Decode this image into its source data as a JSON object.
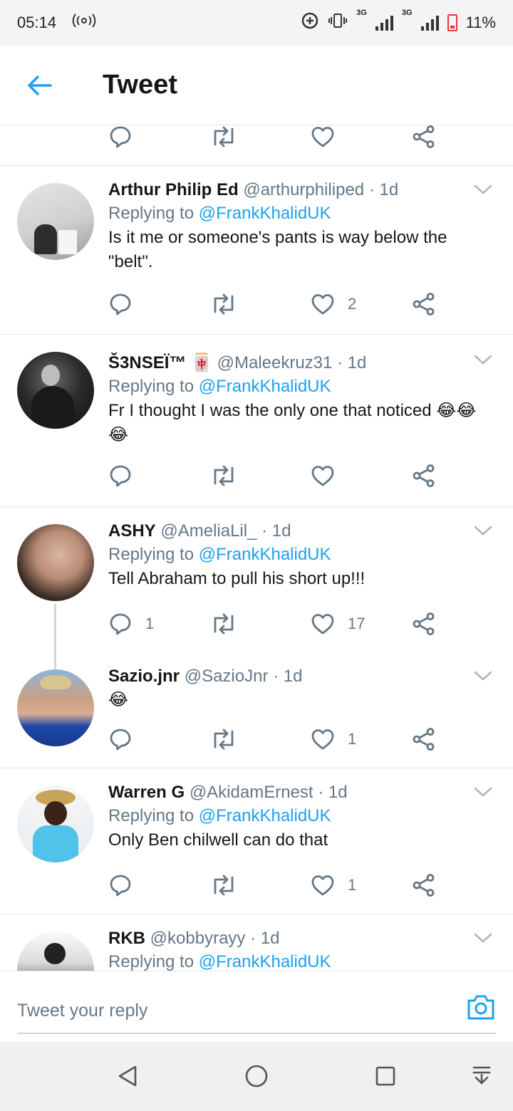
{
  "status_bar": {
    "time": "05:14",
    "network": "3G",
    "battery": "11%"
  },
  "header": {
    "title": "Tweet"
  },
  "tweets": [
    {
      "name": "Arthur Philip Ed",
      "handle": "@arthurphiliped",
      "time": "· 1d",
      "replying_prefix": "Replying to",
      "replying_to": "@FrankKhalidUK",
      "text": "Is it me or someone's pants is way below the \"belt\".",
      "replies": "",
      "likes": "2"
    },
    {
      "name": "Š3NSEÏ™",
      "badge": "🀄",
      "handle": "@Maleekruz31",
      "time": "· 1d",
      "replying_prefix": "Replying to",
      "replying_to": "@FrankKhalidUK",
      "text": "Fr I thought I was the only one that noticed 😂😂😂",
      "replies": "",
      "likes": ""
    },
    {
      "name": "ASHY",
      "handle": "@AmeliaLil_",
      "time": "· 1d",
      "replying_prefix": "Replying to",
      "replying_to": "@FrankKhalidUK",
      "text": "Tell Abraham to pull his short up!!!",
      "replies": "1",
      "likes": "17"
    },
    {
      "name": "Sazio.jnr",
      "handle": "@SazioJnr",
      "time": "· 1d",
      "text": "😂",
      "replies": "",
      "likes": "1"
    },
    {
      "name": "Warren G",
      "handle": "@AkidamErnest",
      "time": "· 1d",
      "replying_prefix": "Replying to",
      "replying_to": "@FrankKhalidUK",
      "text": "Only Ben chilwell can do that",
      "replies": "",
      "likes": "1"
    },
    {
      "name": "RKB",
      "handle": "@kobbyrayy",
      "time": "· 1d",
      "replying_prefix": "Replying to",
      "replying_to": "@FrankKhalidUK"
    }
  ],
  "composer": {
    "placeholder": "Tweet your reply"
  },
  "colors": {
    "accent": "#1da1f2",
    "secondary_text": "#657786",
    "divider": "#e1e8ed"
  },
  "icons": [
    "back-arrow-icon",
    "reply-icon",
    "retweet-icon",
    "like-icon",
    "share-icon",
    "chevron-down-icon",
    "camera-icon"
  ]
}
